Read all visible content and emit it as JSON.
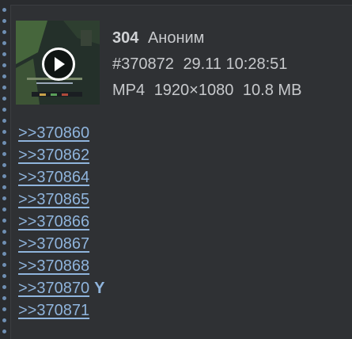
{
  "post": {
    "number": "304",
    "author": "Аноним",
    "id": "#370872",
    "datetime": "29.11 10:28:51",
    "file": {
      "format": "MP4",
      "resolution": "1920×1080",
      "size": "10.8 MB",
      "thumbnail_icon": "play-icon"
    }
  },
  "replies": [
    {
      "label": ">>370860",
      "mark": ""
    },
    {
      "label": ">>370862",
      "mark": ""
    },
    {
      "label": ">>370864",
      "mark": ""
    },
    {
      "label": ">>370865",
      "mark": ""
    },
    {
      "label": ">>370866",
      "mark": ""
    },
    {
      "label": ">>370867",
      "mark": ""
    },
    {
      "label": ">>370868",
      "mark": ""
    },
    {
      "label": ">>370870",
      "mark": "Y"
    },
    {
      "label": ">>370871",
      "mark": ""
    }
  ],
  "colors": {
    "background": "#2a2c2f",
    "post_background": "#2f3134",
    "link": "#8fb4dc",
    "text": "#c7c9cc",
    "rail_dot": "#6f8fb3"
  }
}
